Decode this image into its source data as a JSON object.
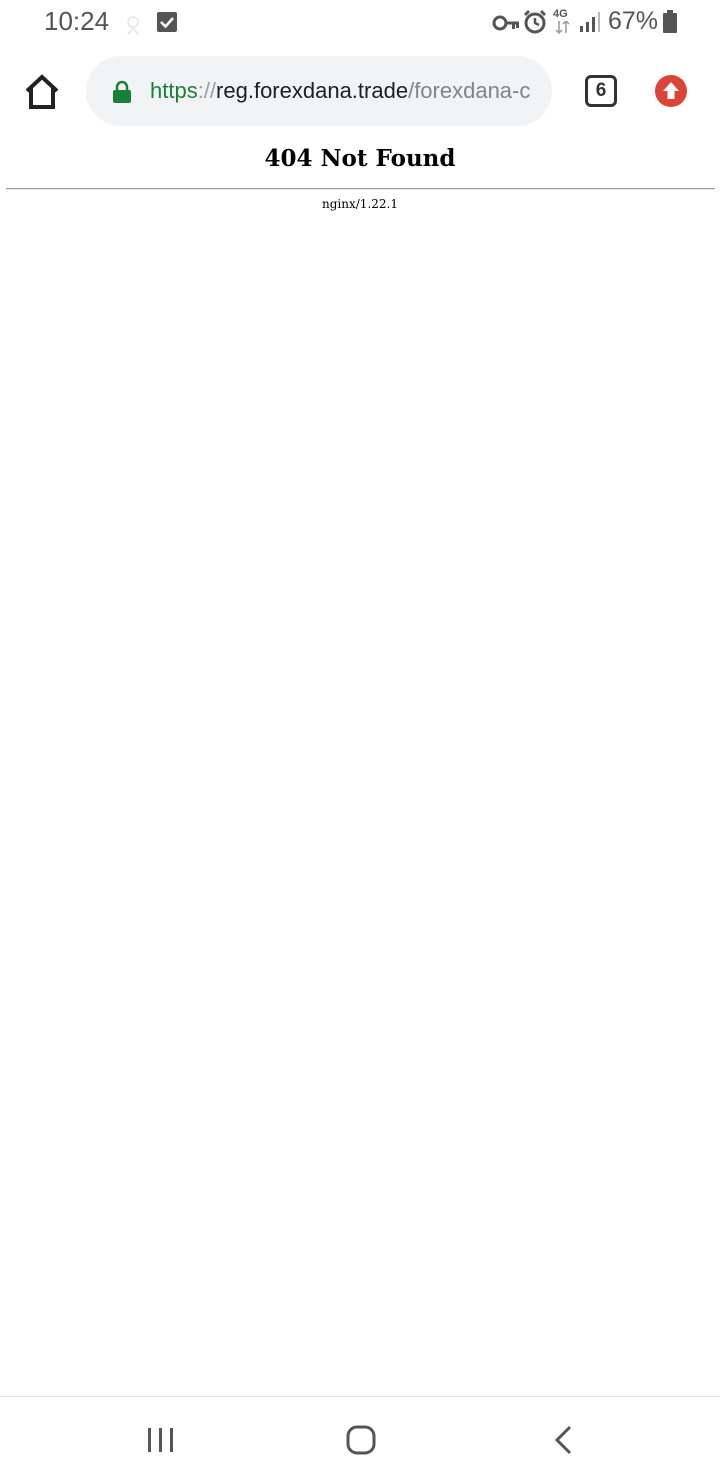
{
  "status_bar": {
    "time": "10:24",
    "network": "4G",
    "battery": "67%",
    "icons": [
      "notification-placeholder-icon",
      "checkbox-notification-icon",
      "vpn-key-icon",
      "alarm-icon",
      "mobile-data-icon",
      "signal-icon",
      "battery-icon"
    ]
  },
  "toolbar": {
    "url_scheme": "https",
    "url_separator": "://",
    "url_host": "reg.forexdana.trade",
    "url_path": "/forexdana-c",
    "tab_count": "6",
    "icons": [
      "home-icon",
      "lock-icon",
      "update-icon"
    ]
  },
  "page": {
    "heading": "404 Not Found",
    "server": "nginx/1.22.1"
  },
  "nav_bar": {
    "icons": [
      "recent-apps-icon",
      "home-nav-icon",
      "back-icon"
    ]
  },
  "colors": {
    "secure_green": "#188038",
    "update_red": "#db4437",
    "url_pill_bg": "#f1f3f4"
  }
}
